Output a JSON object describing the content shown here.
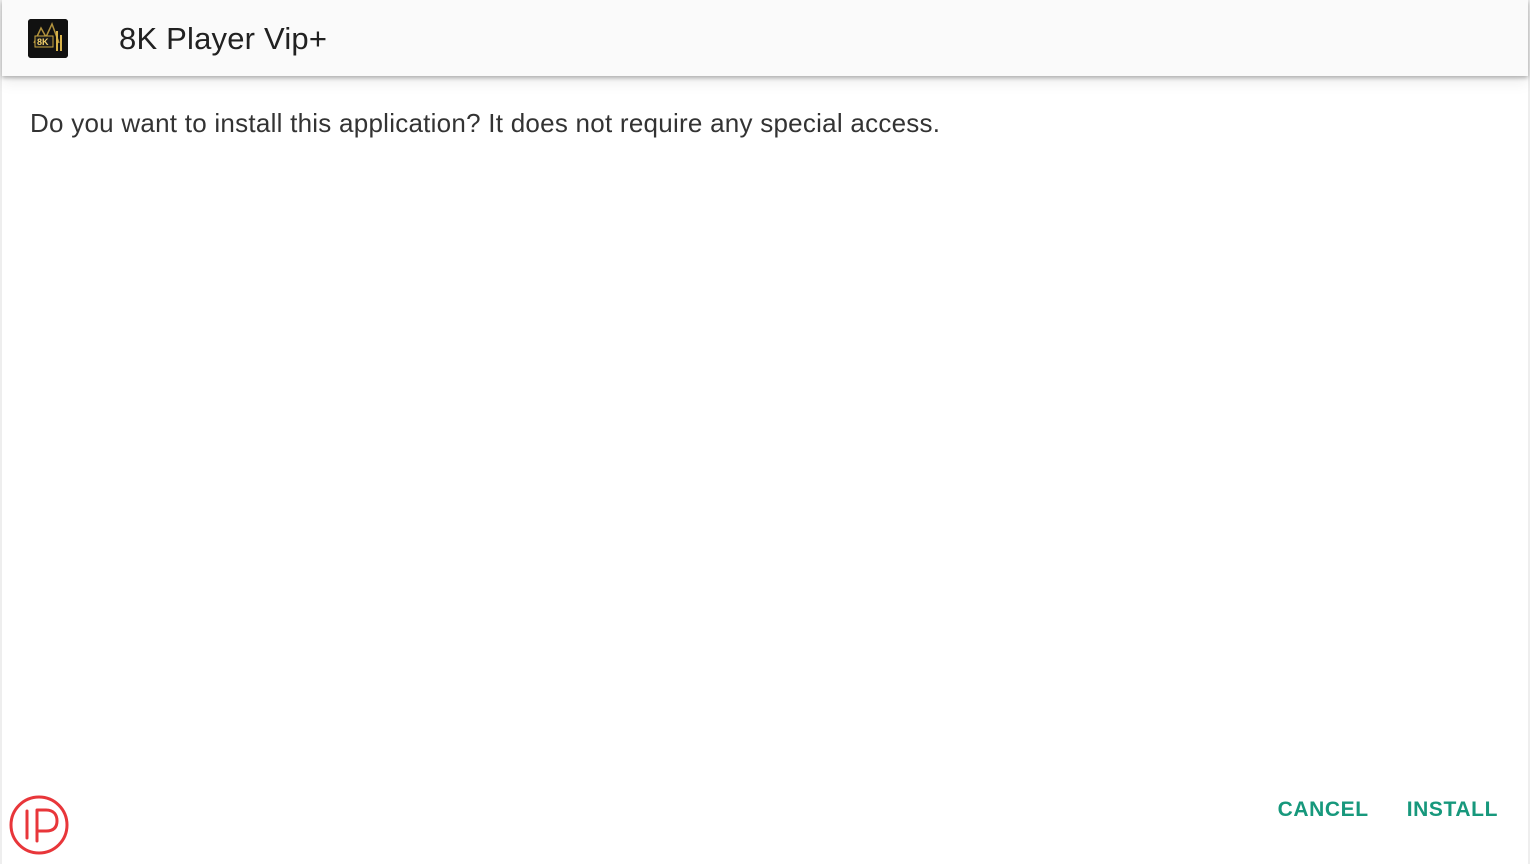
{
  "app": {
    "title": "8K Player Vip+",
    "icon_name": "8k-player-app-icon",
    "icon_text": "8K"
  },
  "dialog": {
    "message": "Do you want to install this application? It does not require any special access."
  },
  "actions": {
    "cancel_label": "CANCEL",
    "install_label": "INSTALL"
  },
  "watermark": {
    "icon_name": "iptv-logo-watermark",
    "letters": "IP"
  },
  "colors": {
    "accent": "#17987c",
    "title_text": "#212121",
    "body_text": "#333333",
    "watermark": "#e8363a"
  }
}
